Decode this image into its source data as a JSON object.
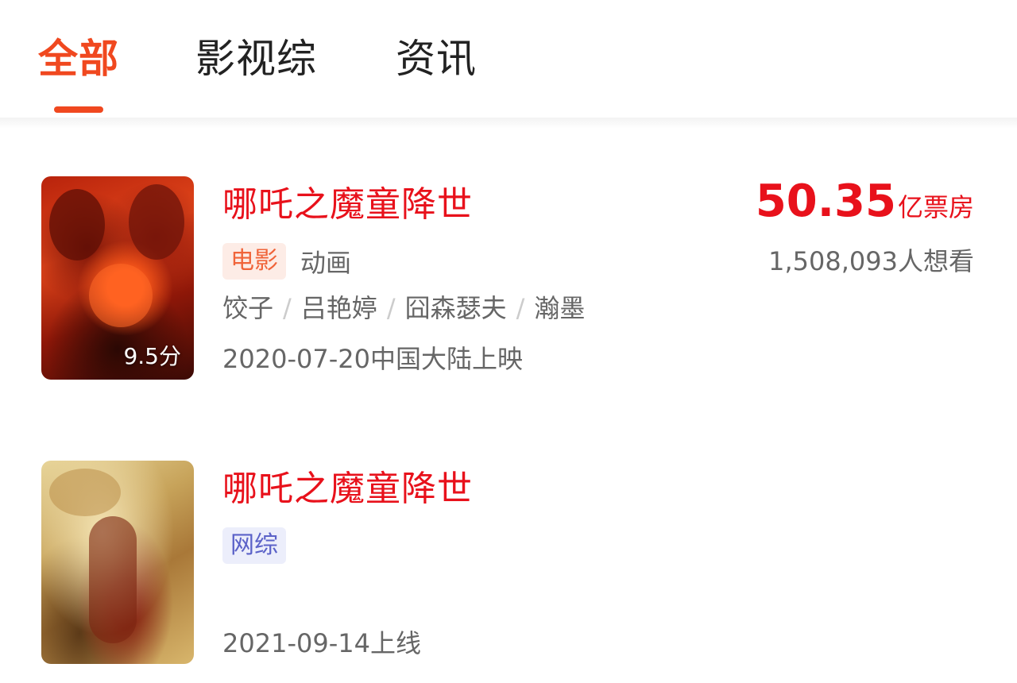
{
  "tabs": [
    {
      "label": "全部",
      "active": true
    },
    {
      "label": "影视综",
      "active": false
    },
    {
      "label": "资讯",
      "active": false
    }
  ],
  "accent_color": "#f0481f",
  "results": [
    {
      "title": "哪吒之魔童降世",
      "score": "9.5分",
      "tag": "电影",
      "genre": "动画",
      "cast": [
        "饺子",
        "吕艳婷",
        "囧森瑟夫",
        "瀚墨"
      ],
      "cast_separator": "/",
      "date": "2020-07-20中国大陆上映",
      "box_office_value": "50.35",
      "box_office_unit": "亿票房",
      "want_to_see": "1,508,093人想看"
    },
    {
      "title": "哪吒之魔童降世",
      "tag": "网综",
      "date": "2021-09-14上线"
    }
  ]
}
